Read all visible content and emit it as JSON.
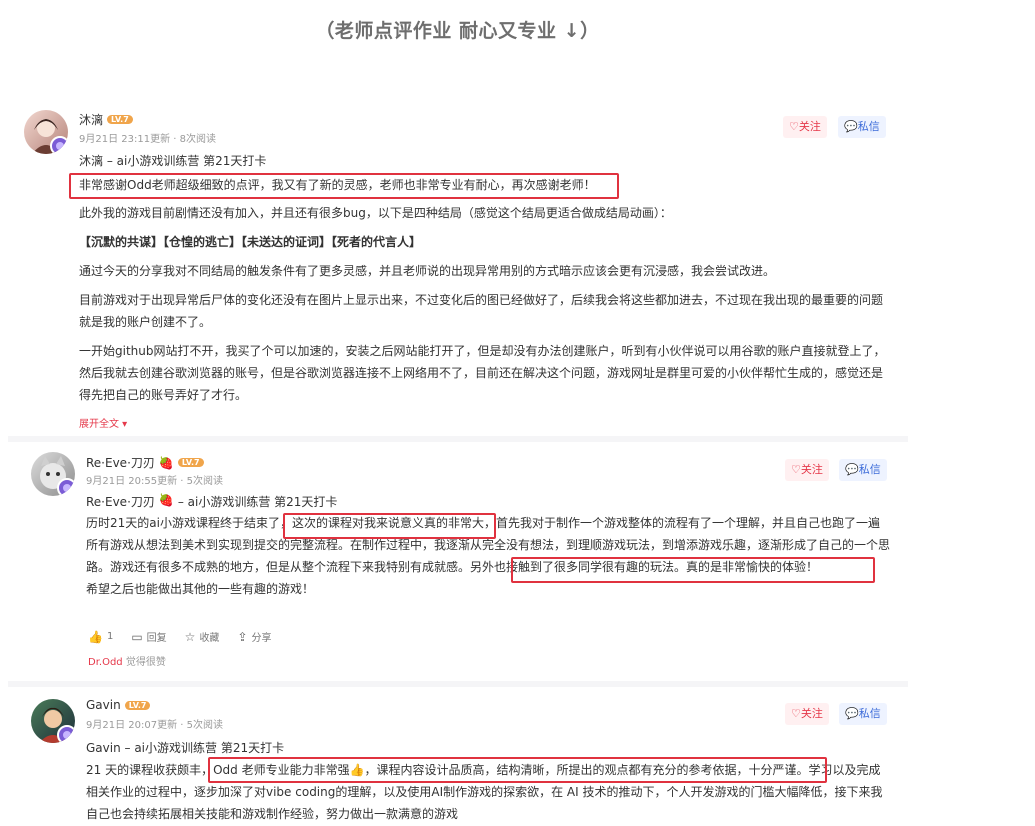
{
  "header": {
    "banner": "（老师点评作业 耐心又专业 ↓）"
  },
  "colors": {
    "highlight": "#e0323f",
    "follow": "#e5384a",
    "message": "#3d6cd9",
    "level": "#f0a54b"
  },
  "posts": [
    {
      "username": "沐漓",
      "level": "LV.7",
      "meta": "9月21日 23:11更新 · 8次阅读",
      "title": "沐漓 – ai小游戏训练营 第21天打卡",
      "follow_label": "关注",
      "message_label": "私信",
      "highlight": "非常感谢Odd老师超级细致的点评，我又有了新的灵感，老师也非常专业有耐心，再次感谢老师！",
      "paragraphs": [
        "此外我的游戏目前剧情还没有加入，并且还有很多bug，以下是四种结局（感觉这个结局更适合做成结局动画）：",
        "【沉默的共谋】【仓惶的逃亡】【未送达的证词】【死者的代言人】",
        "通过今天的分享我对不同结局的触发条件有了更多灵感，并且老师说的出现异常用别的方式暗示应该会更有沉浸感，我会尝试改进。",
        "目前游戏对于出现异常后尸体的变化还没有在图片上显示出来，不过变化后的图已经做好了，后续我会将这些都加进去，不过现在我出现的最重要的问题就是我的账户创建不了。",
        "一开始github网站打不开，我买了个可以加速的，安装之后网站能打开了，但是却没有办法创建账户，听到有小伙伴说可以用谷歌的账户直接就登上了，然后我就去创建谷歌浏览器的账号，但是谷歌浏览器连接不上网络用不了，目前还在解决这个问题，游戏网址是群里可爱的小伙伴帮忙生成的，感觉还是得先把自己的账号弄好了才行。"
      ],
      "expand_label": "展开全文 ▾"
    },
    {
      "username": "Re·Eve·刀刃",
      "level": "LV.7",
      "meta": "9月21日 20:55更新 · 5次阅读",
      "title": "Re·Eve·刀刃",
      "title_suffix": "– ai小游戏训练营 第21天打卡",
      "follow_label": "关注",
      "message_label": "私信",
      "body_pre": "历时21天的ai小游戏课程终于结束了，",
      "highlight_1": "这次的课程对我来说意义真的非常大",
      "body_mid": "，首先我对于制作一个游戏整体的流程有了一个理解，并且自己也跑了一遍所有游戏从想法到美术到实现到提交的完整流程。在制作过程中，我逐渐从完全没有想法，到理顺游戏玩法，到增添游戏乐趣，逐渐形成了自己的一个思路。游戏还有很多不成熟的地方，但是从整个流程下来我特别有成就感。",
      "highlight_2": "另外也接触到了很多同学很有趣的玩法。真的是非常愉快的体验！",
      "body_post": "希望之后也能做出其他的一些有趣的游戏！",
      "like_count": "1",
      "reply_label": "回复",
      "collect_label": "收藏",
      "share_label": "分享",
      "liked_by": "Dr.Odd",
      "liked_suffix": "觉得很赞"
    },
    {
      "username": "Gavin",
      "level": "LV.7",
      "meta": "9月21日 20:07更新 · 5次阅读",
      "title": "Gavin – ai小游戏训练营 第21天打卡",
      "follow_label": "关注",
      "message_label": "私信",
      "body_pre": "21 天的课程收获颇丰，",
      "highlight": "Odd 老师专业能力非常强👍，课程内容设计品质高，结构清晰，所提出的观点都有充分的参考依据，十分严谨。",
      "body_post": "学习以及完成相关作业的过程中，逐步加深了对vibe coding的理解，以及使用AI制作游戏的探索欲，在 AI 技术的推动下，个人开发游戏的门槛大幅降低，接下来我自己也会持续拓展相关技能和游戏制作经验，努力做出一款满意的游戏"
    }
  ]
}
